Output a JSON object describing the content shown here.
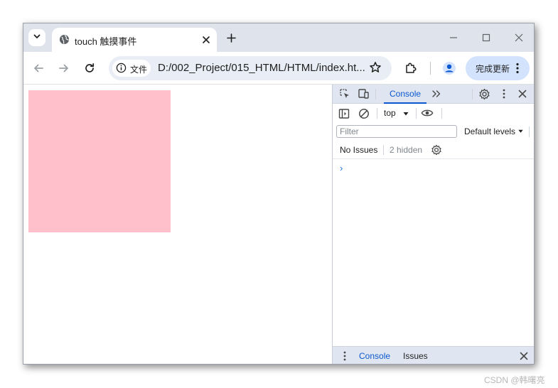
{
  "tab": {
    "title": "touch 触摸事件",
    "icon": "globe-icon"
  },
  "toolbar": {
    "security_chip_label": "文件",
    "url": "D:/002_Project/015_HTML/HTML/index.ht...",
    "update_button_label": "完成更新"
  },
  "page": {
    "box_color": "#ffc0cb"
  },
  "devtools": {
    "tabs": {
      "active": "Console"
    },
    "context": "top",
    "filter_placeholder": "Filter",
    "levels": "Default levels",
    "issues": "No Issues",
    "hidden": "2 hidden",
    "prompt": "›",
    "drawer": {
      "console": "Console",
      "issues": "Issues"
    }
  },
  "watermark": "CSDN @韩曙亮",
  "colors": {
    "accent": "#0b57d0",
    "tabstrip": "#dfe3eb",
    "omnibox": "#e9edf5",
    "update_button": "#d3e3fd"
  }
}
